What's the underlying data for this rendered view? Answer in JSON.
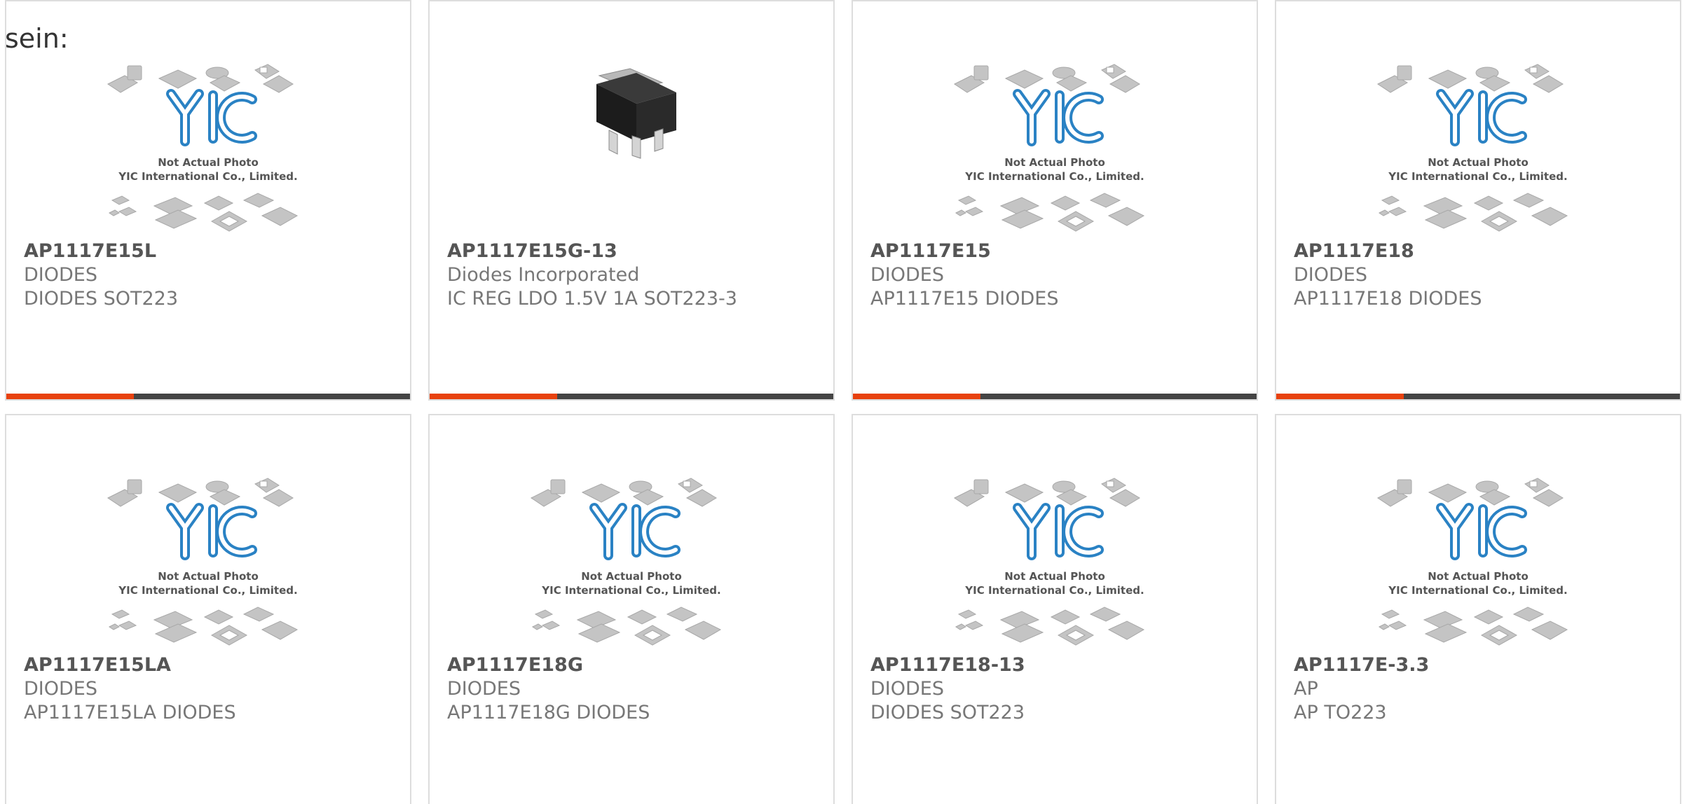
{
  "intro_text": "sein:",
  "placeholder": {
    "line1": "Not Actual Photo",
    "line2": "YIC International Co., Limited."
  },
  "colors": {
    "accent": "#e8410e",
    "bar": "#444444",
    "logo": "#2a82c4",
    "border": "#dddddd"
  },
  "products": [
    {
      "part": "AP1117E15L",
      "brand": "DIODES",
      "desc": "DIODES SOT223",
      "image": "placeholder",
      "accent_bar": true
    },
    {
      "part": "AP1117E15G-13",
      "brand": "Diodes Incorporated",
      "desc": "IC REG LDO 1.5V 1A SOT223-3",
      "image": "sot223-chip-photo",
      "accent_bar": true
    },
    {
      "part": "AP1117E15",
      "brand": "DIODES",
      "desc": "AP1117E15 DIODES",
      "image": "placeholder",
      "accent_bar": true
    },
    {
      "part": "AP1117E18",
      "brand": "DIODES",
      "desc": "AP1117E18 DIODES",
      "image": "placeholder",
      "accent_bar": true
    },
    {
      "part": "AP1117E15LA",
      "brand": "DIODES",
      "desc": "AP1117E15LA DIODES",
      "image": "placeholder",
      "accent_bar": false
    },
    {
      "part": "AP1117E18G",
      "brand": "DIODES",
      "desc": "AP1117E18G DIODES",
      "image": "placeholder",
      "accent_bar": false
    },
    {
      "part": "AP1117E18-13",
      "brand": "DIODES",
      "desc": "DIODES SOT223",
      "image": "placeholder",
      "accent_bar": false
    },
    {
      "part": "AP1117E-3.3",
      "brand": "AP",
      "desc": "AP TO223",
      "image": "placeholder",
      "accent_bar": false
    }
  ]
}
